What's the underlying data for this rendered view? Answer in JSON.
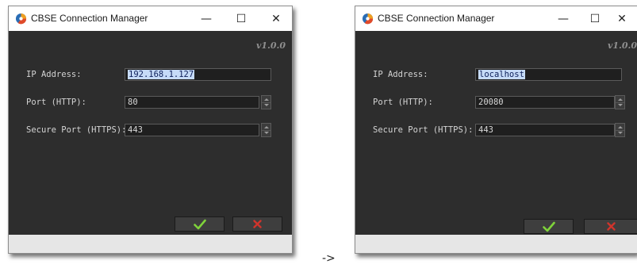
{
  "windows": [
    {
      "title": "CBSE Connection Manager",
      "controls": {
        "minimize": "—",
        "maximize": "☐",
        "close": "✕"
      },
      "version": "v1.0.0",
      "fields": {
        "ip_label": "IP Address:",
        "ip_value": "192.168.1.127",
        "port_label": "Port (HTTP):",
        "port_value": "80",
        "secure_label": "Secure Port (HTTPS):",
        "secure_value": "443"
      },
      "buttons": {
        "ok_icon": "checkmark-icon",
        "cancel_icon": "x-icon"
      }
    },
    {
      "title": "CBSE Connection Manager",
      "controls": {
        "minimize": "—",
        "maximize": "☐",
        "close": "✕"
      },
      "version": "v1.0.0",
      "fields": {
        "ip_label": "IP Address:",
        "ip_value": "localhost",
        "port_label": "Port (HTTP):",
        "port_value": "20080",
        "secure_label": "Secure Port (HTTPS):",
        "secure_value": "443"
      },
      "buttons": {
        "ok_icon": "checkmark-icon",
        "cancel_icon": "x-icon"
      }
    }
  ],
  "arrow": "->",
  "colors": {
    "panel_bg": "#2d2d2d",
    "ok_green": "#7fd33a",
    "cancel_red": "#d0342c",
    "selection": "#c6dbf7"
  }
}
